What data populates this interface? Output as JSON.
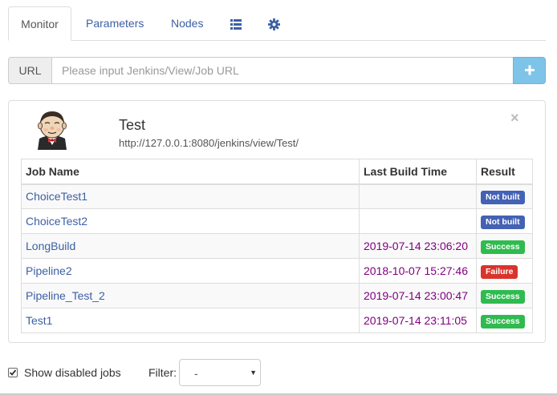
{
  "tabs": {
    "monitor": "Monitor",
    "parameters": "Parameters",
    "nodes": "Nodes",
    "list_icon": "list-icon",
    "settings_icon": "gear-icon"
  },
  "url_bar": {
    "label": "URL",
    "placeholder": "Please input Jenkins/View/Job URL",
    "value": "",
    "add_icon": "plus-icon"
  },
  "view": {
    "title": "Test",
    "url": "http://127.0.0.1:8080/jenkins/view/Test/",
    "close": "×"
  },
  "table": {
    "headers": [
      "Job Name",
      "Last Build Time",
      "Result"
    ],
    "rows": [
      {
        "name": "ChoiceTest1",
        "time": "",
        "result": "Not built",
        "color": "#4361b5"
      },
      {
        "name": "ChoiceTest2",
        "time": "",
        "result": "Not built",
        "color": "#4361b5"
      },
      {
        "name": "LongBuild",
        "time": "2019-07-14 23:06:20",
        "result": "Success",
        "color": "#2fbb4f"
      },
      {
        "name": "Pipeline2",
        "time": "2018-10-07 15:27:46",
        "result": "Failure",
        "color": "#d9342b"
      },
      {
        "name": "Pipeline_Test_2",
        "time": "2019-07-14 23:00:47",
        "result": "Success",
        "color": "#2fbb4f"
      },
      {
        "name": "Test1",
        "time": "2019-07-14 23:11:05",
        "result": "Success",
        "color": "#2fbb4f"
      }
    ]
  },
  "footer": {
    "show_disabled_label": "Show disabled jobs",
    "show_disabled_checked": true,
    "filter_label": "Filter:",
    "filter_value": "-"
  }
}
